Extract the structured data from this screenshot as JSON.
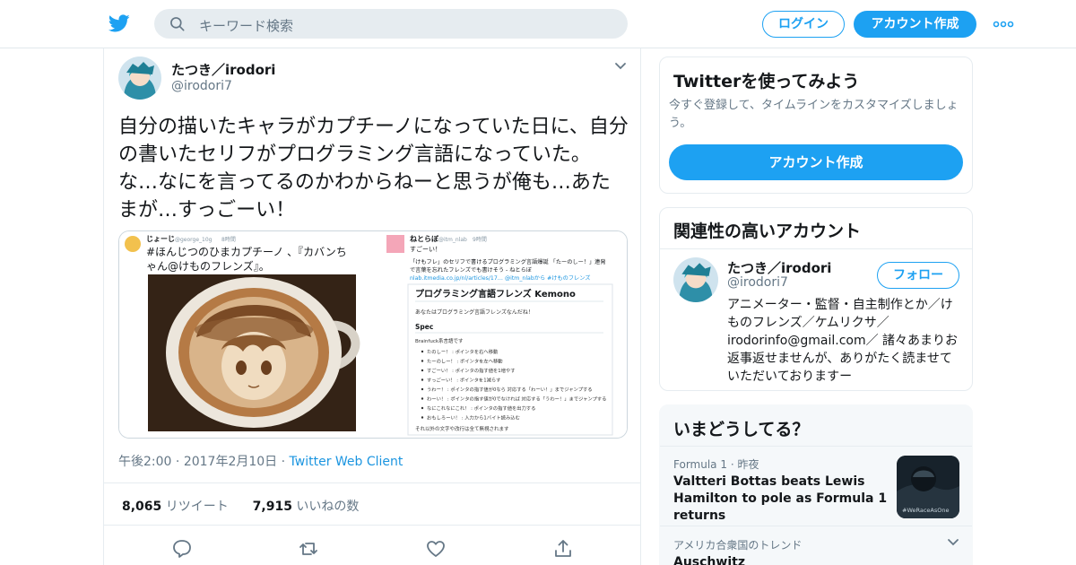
{
  "header": {
    "search_placeholder": "キーワード検索",
    "login_label": "ログイン",
    "signup_label": "アカウント作成",
    "brand_color": "#1da1f2"
  },
  "tweet": {
    "author_name": "たつき／irodori",
    "author_handle": "@irodori7",
    "text": "自分の描いたキャラがカプチーノになっていた日に、自分の書いたセリフがプログラミング言語になっていた。な…なにを言ってるのかわからねーと思うが俺も…あたまが…すっごーい！",
    "time": "午後2:00",
    "date": "2017年2月10日",
    "client": "Twitter Web Client",
    "retweets_count": "8,065",
    "retweets_label": "リツイート",
    "likes_count": "7,915",
    "likes_label": "いいねの数",
    "media": {
      "left_user": "じょーじ",
      "left_handle": "@george_10g",
      "left_time": "8時間",
      "left_text_1": "#ほんじつのひまカプチーノ 、『カバンち",
      "left_text_2": "ゃん@けものフレンズ』。",
      "right_user": "ねとらぼ",
      "right_handle": "@itm_nlab",
      "right_time": "9時間",
      "right_line_1": "すごーい！",
      "right_line_2": "「けもフレ」のセリフで書けるプログラミング言語爆誕 「たーのしー！」連発",
      "right_line_3": "で言葉を忘れたフレンズでも書けそう - ねとらぼ",
      "right_link": "nlab.itmedia.co.jp/nl/articles/17… @itm_nlabから #けものフレンズ",
      "doc_title": "プログラミング言語フレンズ Kemono",
      "doc_intro": "あなたはプログラミング言語フレンズなんだね！",
      "doc_spec": "Spec",
      "doc_brainfuck": "Brainfuck系言語です",
      "doc_items": [
        "たのしー！ : ポインタを右へ移動",
        "たーのしー！ : ポインタを左へ移動",
        "すごーい！ : ポインタの指す値を1増やす",
        "すっごーい！ : ポインタを1減らす",
        "うわー！ : ポインタの指す値が0なら 対応する「わーい！」までジャンプする",
        "わーい！ : ポインタの指す値が0でなければ 対応する「うわー！」までジャンプする",
        "なにこれなにこれ！ : ポインタの指す値を出力する",
        "おもしろーい！ : 入力から1バイト読み込む"
      ],
      "doc_footer": "それ以外の文字や改行は全て無視されます"
    }
  },
  "sidebar": {
    "try_title": "Twitterを使ってみよう",
    "try_desc": "今すぐ登録して、タイムラインをカスタマイズしましょう。",
    "try_button": "アカウント作成",
    "related_title": "関連性の高いアカウント",
    "related_name": "たつき／irodori",
    "related_handle": "@irodori7",
    "follow_label": "フォロー",
    "related_bio": "アニメーター・監督・自主制作とか／けものフレンズ／ケムリクサ／irodorinfo@gmail.com／ 諸々あまりお返事返せませんが、ありがたく読ませていただいておりますー",
    "trends_title": "いまどうしてる？",
    "trend1_category": "Formula 1",
    "trend1_time": "昨夜",
    "trend1_title": "Valtteri Bottas beats Lewis Hamilton to pole as Formula 1 returns",
    "trend1_thumb_text": "#WeRaceAsOne",
    "trend2_category": "アメリカ合衆国のトレンド",
    "trend2_title": "Auschwitz"
  }
}
